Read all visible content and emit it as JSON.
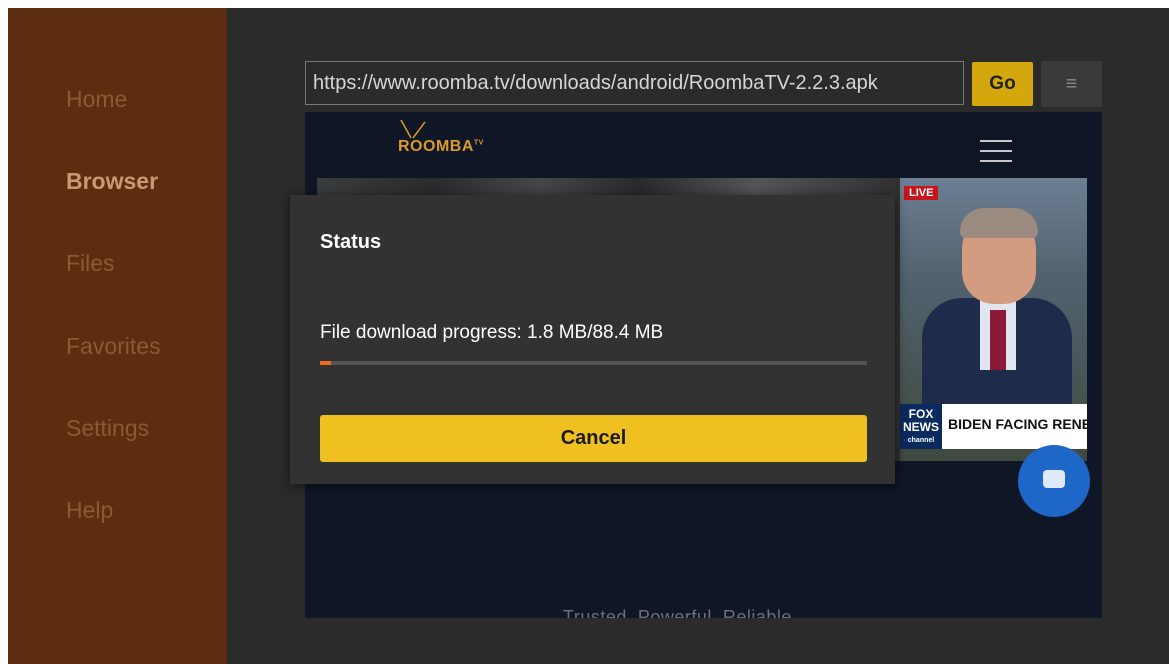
{
  "sidebar": {
    "items": [
      {
        "label": "Home",
        "active": false
      },
      {
        "label": "Browser",
        "active": true
      },
      {
        "label": "Files",
        "active": false
      },
      {
        "label": "Favorites",
        "active": false
      },
      {
        "label": "Settings",
        "active": false
      },
      {
        "label": "Help",
        "active": false
      }
    ]
  },
  "toolbar": {
    "url": "https://www.roomba.tv/downloads/android/RoombaTV-2.2.3.apk",
    "go_label": "Go",
    "menu_icon": "≡"
  },
  "webpage": {
    "logo_text": "ROOMBA",
    "logo_superscript": "TV",
    "banner": {
      "live_label": "LIVE",
      "network_label_1": "FOX",
      "network_label_2": "NEWS",
      "network_label_3": "channel",
      "ticker_text": "BIDEN FACING RENE"
    },
    "tagline": "Trusted. Powerful. Reliable."
  },
  "dialog": {
    "title": "Status",
    "message": "File download progress: 1.8 MB/88.4 MB",
    "progress_fraction": 0.0204,
    "cancel_label": "Cancel"
  },
  "colors": {
    "sidebar_bg": "#5c2e0f",
    "accent": "#f0c020",
    "progress": "#ef6c1e"
  }
}
